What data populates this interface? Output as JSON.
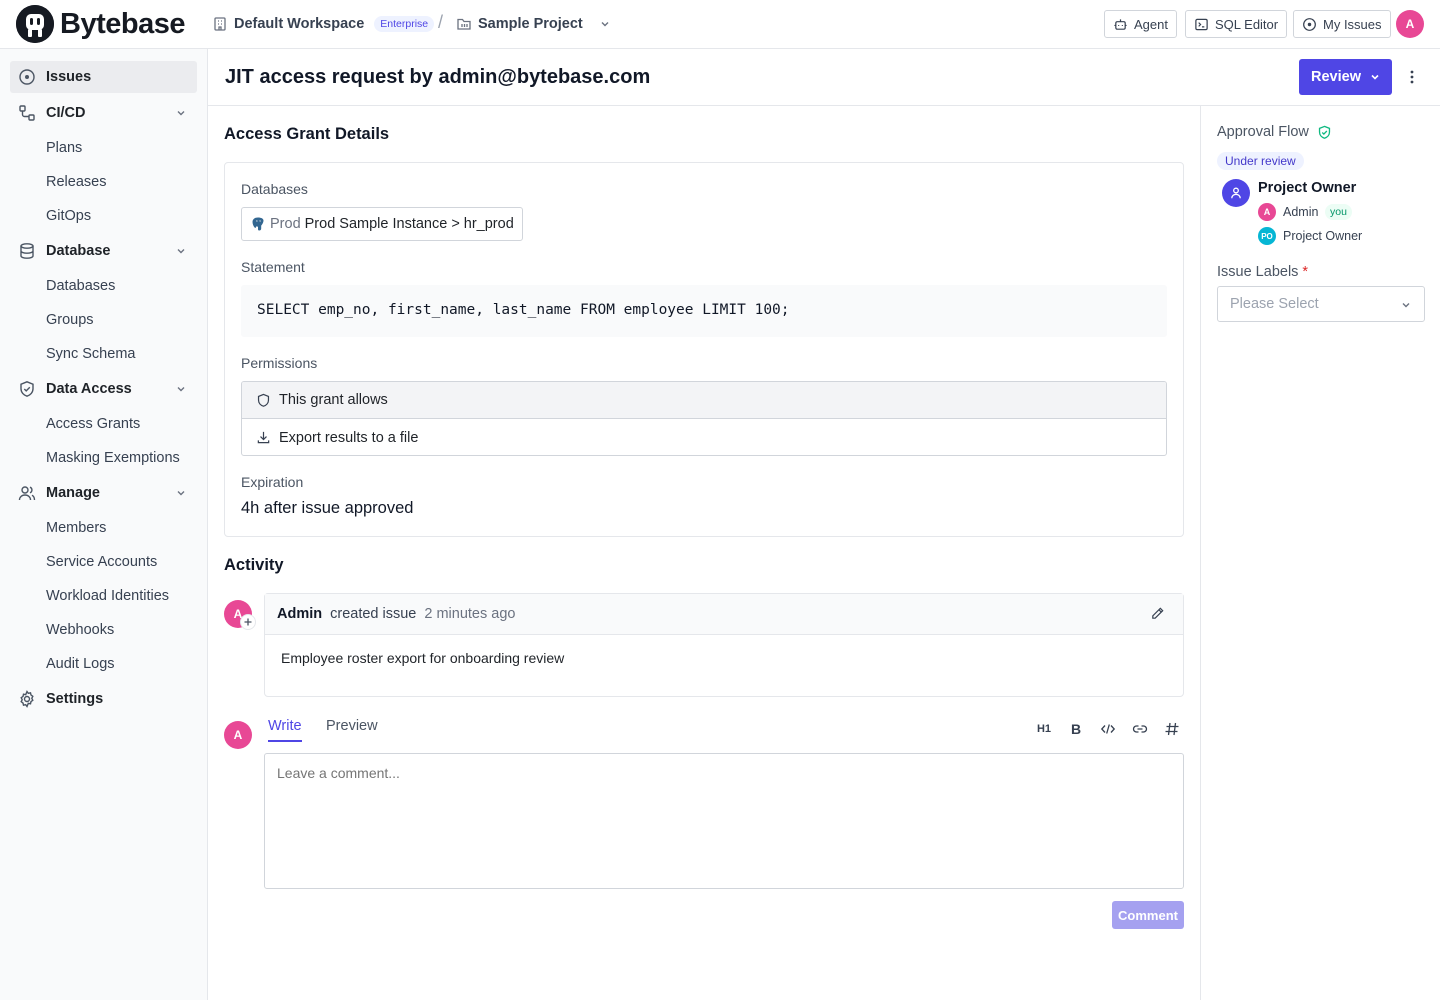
{
  "brand": {
    "name": "Bytebase"
  },
  "topbar": {
    "workspace": "Default Workspace",
    "plan_badge": "Enterprise",
    "separator": "/",
    "project": "Sample Project",
    "buttons": {
      "agent": "Agent",
      "sql_editor": "SQL Editor",
      "my_issues": "My Issues"
    },
    "user_initial": "A"
  },
  "sidebar": {
    "issues": "Issues",
    "cicd": {
      "label": "CI/CD",
      "items": [
        "Plans",
        "Releases",
        "GitOps"
      ]
    },
    "database": {
      "label": "Database",
      "items": [
        "Databases",
        "Groups",
        "Sync Schema"
      ]
    },
    "data_access": {
      "label": "Data Access",
      "items": [
        "Access Grants",
        "Masking Exemptions"
      ]
    },
    "manage": {
      "label": "Manage",
      "items": [
        "Members",
        "Service Accounts",
        "Workload Identities",
        "Webhooks",
        "Audit Logs"
      ]
    },
    "settings": "Settings"
  },
  "header": {
    "title": "JIT access request by admin@bytebase.com",
    "review_label": "Review"
  },
  "grant": {
    "section_title": "Access Grant Details",
    "databases_label": "Databases",
    "database": {
      "env": "Prod",
      "instance": "Prod Sample Instance",
      "separator": ">",
      "name": "hr_prod"
    },
    "statement_label": "Statement",
    "statement": "SELECT emp_no, first_name, last_name FROM employee LIMIT 100;",
    "permissions_label": "Permissions",
    "permissions_header": "This grant allows",
    "permissions": [
      "Export results to a file"
    ],
    "expiration_label": "Expiration",
    "expiration": "4h after issue approved"
  },
  "activity": {
    "section_title": "Activity",
    "entry": {
      "avatar_initial": "A",
      "author": "Admin",
      "action": "created issue",
      "time": "2 minutes ago",
      "body": "Employee roster export for onboarding review"
    },
    "composer": {
      "avatar_initial": "A",
      "tab_write": "Write",
      "tab_preview": "Preview",
      "heading_label": "H1",
      "bold_label": "B",
      "placeholder": "Leave a comment...",
      "submit_label": "Comment"
    }
  },
  "approval": {
    "title": "Approval Flow",
    "status": "Under review",
    "role": "Project Owner",
    "approvers": [
      {
        "initials": "A",
        "name": "Admin",
        "badge": "you",
        "color": "#e84895"
      },
      {
        "initials": "PO",
        "name": "Project Owner",
        "color": "#06b6d4"
      }
    ],
    "labels_title": "Issue Labels",
    "labels_required": "*",
    "labels_placeholder": "Please Select"
  },
  "colors": {
    "accent": "#4f46e5",
    "avatar": "#e84895",
    "success": "#059669"
  }
}
